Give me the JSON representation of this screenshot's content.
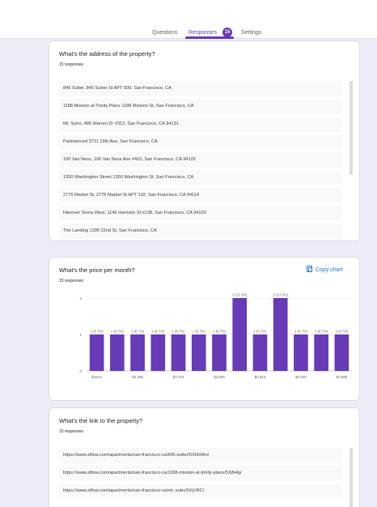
{
  "tabs": [
    {
      "label": "Questions"
    },
    {
      "label": "Responses"
    },
    {
      "label": "Settings"
    }
  ],
  "responses_count": "15",
  "q1": {
    "title": "What's the address of the property?",
    "count": "15 responses",
    "answers": [
      "845 Sutter, 845 Sutter St APT 509, San Francisco, CA",
      "1188 Mission at Trinity Place 1188 Mission St, San Francisco, CA",
      "Mt. Sutro, 480 Warren Dr #312, San Francisco, CA 94131",
      "Parkmerced 3711 19th Ave, San Francisco, CA",
      "100 Van Ness, 100 Van Ness Ave #410, San Francisco, CA 94102",
      "1350 Washington Street 1350 Washington St, San Francisco, CA",
      "2775 Market St, 2775 Market St APT 102, San Francisco, CA 94114",
      "Hanover Soma West, 1140 Harrison St #138, San Francisco, CA 94103",
      "The Landing 1395 22nd St, San Francisco, CA"
    ]
  },
  "q2": {
    "title": "What's the price per month?",
    "count": "15 responses",
    "copy_label": "Copy chart"
  },
  "q3": {
    "title": "What's the link to the property?",
    "count": "15 responses",
    "answers": [
      "https://www.zillow.com/apartments/san-francisco-ca/845-sutter/5XkKMm/",
      "https://www.zillow.com/apartments/san-francisco-ca/1188-mission-at-trinity-place/5XjN4g/",
      "https://www.zillow.com/apartments/san-francisco-ca/mt.-sutro/5XjVRC/"
    ]
  },
  "colors": {
    "accent": "#673ab7",
    "bar": "#673ab7",
    "link": "#1a73e8"
  },
  "chart_data": {
    "type": "bar",
    "ylim": [
      0,
      2
    ],
    "yticks": [
      "0",
      "1",
      "2"
    ],
    "categories": [
      "$1914",
      "",
      "$2,395",
      "",
      "$2,704",
      "",
      "$2,805",
      "",
      "$2,816",
      "",
      "$2,940",
      "",
      "$2,995"
    ],
    "values": [
      1,
      1,
      1,
      1,
      1,
      1,
      1,
      2,
      1,
      2,
      1,
      1,
      1
    ],
    "data_labels": [
      "1 (6.7%)",
      "1 (6.7%)",
      "1 (6.7%)",
      "1 (6.7%)",
      "1 (6.7%)",
      "1 (6.7%)",
      "1 (6.7%)",
      "2 (13.3%)",
      "1 (6.7%)",
      "2 (13.3%)",
      "1 (6.7%)",
      "1 (6.7%)",
      "1 (6.7%)"
    ]
  }
}
